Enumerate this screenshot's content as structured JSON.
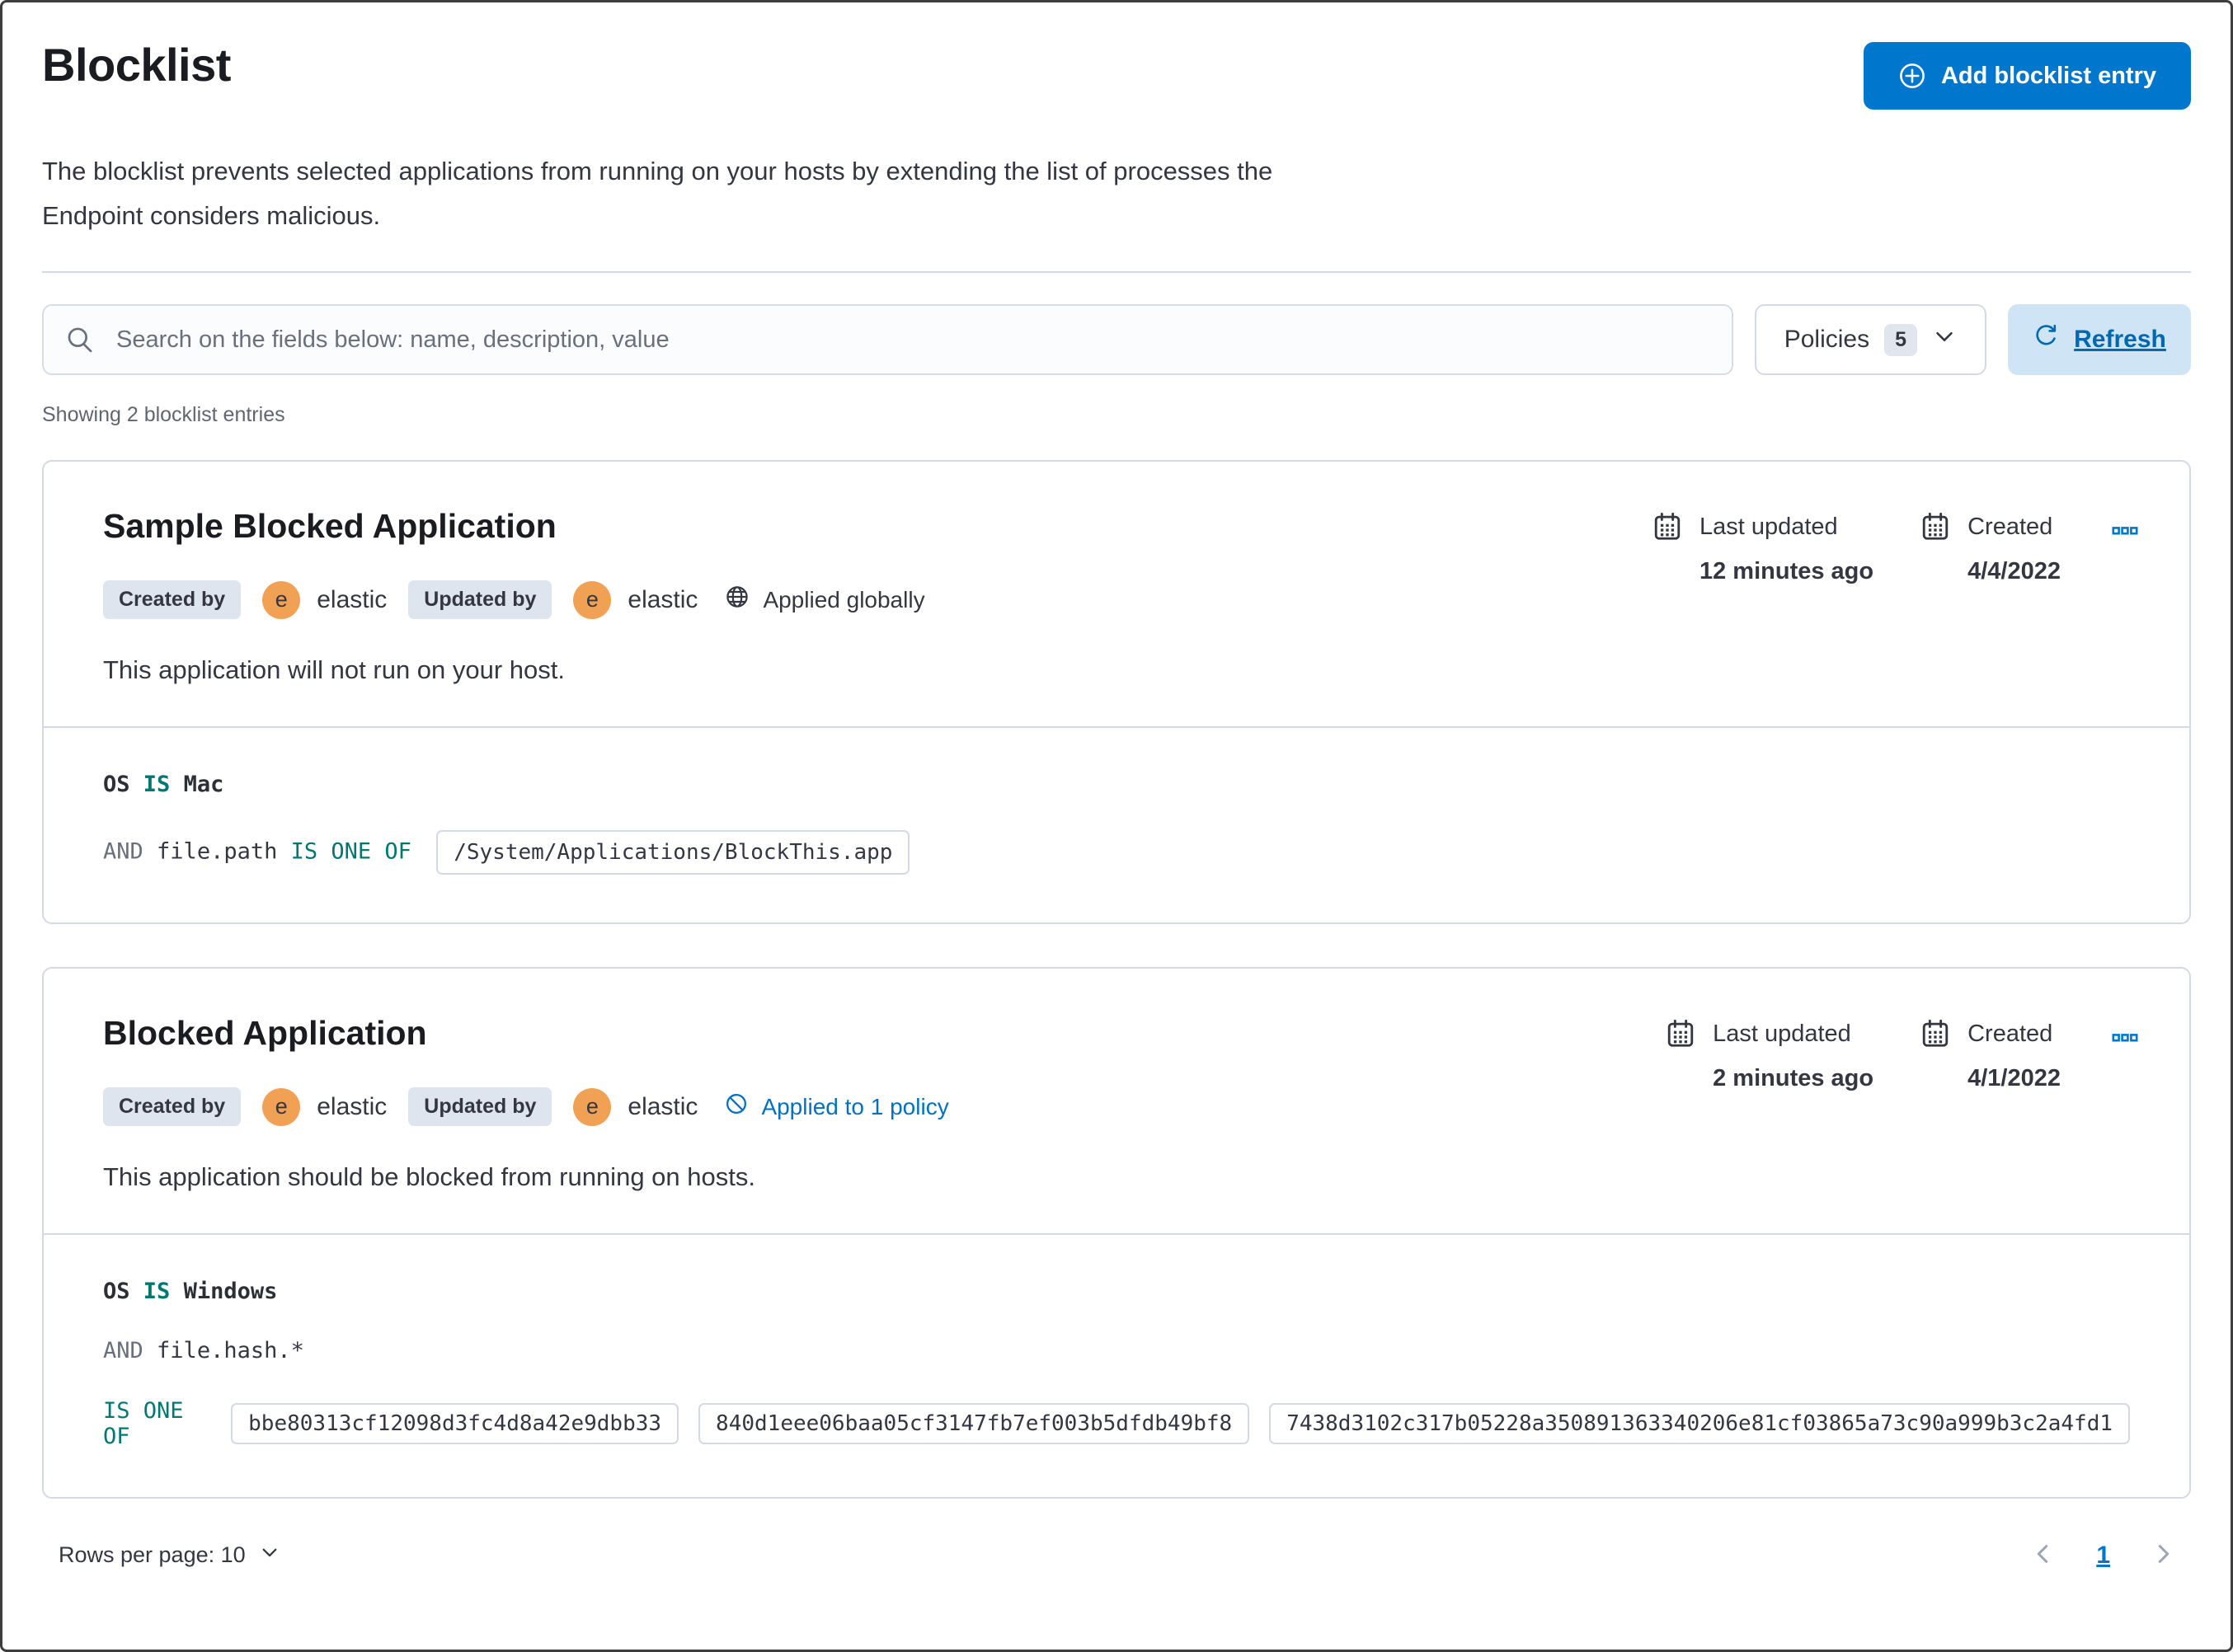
{
  "page": {
    "title": "Blocklist",
    "description_line1": "The blocklist prevents selected applications from running on your hosts by extending the list of processes the",
    "description_line2": "Endpoint considers malicious.",
    "add_button_label": "Add blocklist entry",
    "search_placeholder": "Search on the fields below: name, description, value",
    "policies_label": "Policies",
    "policies_count": "5",
    "refresh_label": "Refresh",
    "results_count": "Showing 2 blocklist entries"
  },
  "colors": {
    "primary_blue": "#0077CC",
    "link_blue": "#0071c2",
    "operator_teal": "#007871",
    "avatar_orange": "#F1A154",
    "badge_gray": "#dfe5ef",
    "border_gray": "#D3DAE6"
  },
  "entries": [
    {
      "title": "Sample Blocked Application",
      "created_by_label": "Created by",
      "created_by_user": "elastic",
      "updated_by_label": "Updated by",
      "updated_by_user": "elastic",
      "avatar_initial": "e",
      "scope_label": "Applied globally",
      "last_updated_label": "Last updated",
      "last_updated_value": "12 minutes ago",
      "created_label": "Created",
      "created_value": "4/4/2022",
      "description": "This application will not run on your host.",
      "criteria": {
        "os_field": "OS",
        "os_operator": "IS",
        "os_value": "Mac",
        "conjunction": "AND",
        "field": "file.path",
        "operator": "IS ONE OF",
        "values": [
          "/System/Applications/BlockThis.app"
        ]
      }
    },
    {
      "title": "Blocked Application",
      "created_by_label": "Created by",
      "created_by_user": "elastic",
      "updated_by_label": "Updated by",
      "updated_by_user": "elastic",
      "avatar_initial": "e",
      "scope_label": "Applied to 1 policy",
      "last_updated_label": "Last updated",
      "last_updated_value": "2 minutes ago",
      "created_label": "Created",
      "created_value": "4/1/2022",
      "description": "This application should be blocked from running on hosts.",
      "criteria": {
        "os_field": "OS",
        "os_operator": "IS",
        "os_value": "Windows",
        "conjunction": "AND",
        "field": "file.hash.*",
        "operator": "IS ONE OF",
        "values": [
          "bbe80313cf12098d3fc4d8a42e9dbb33",
          "840d1eee06baa05cf3147fb7ef003b5dfdb49bf8",
          "7438d3102c317b05228a350891363340206e81cf03865a73c90a999b3c2a4fd1"
        ]
      }
    }
  ],
  "footer": {
    "rows_per_page_label": "Rows per page: 10",
    "page_number": "1"
  }
}
